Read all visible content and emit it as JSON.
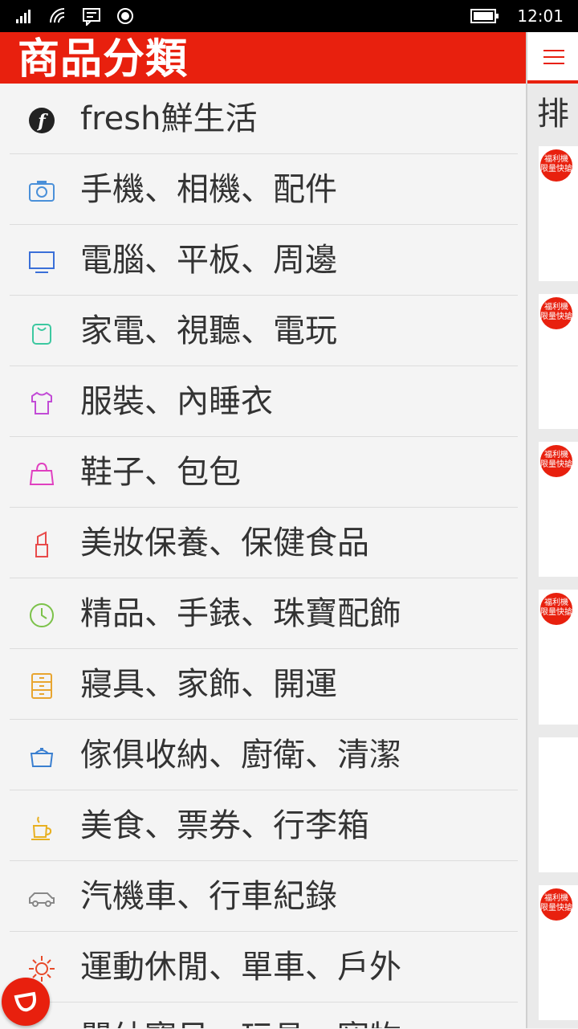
{
  "status_bar": {
    "time": "12:01",
    "icons": [
      "signal-icon",
      "wifi-icon",
      "message-icon",
      "location-icon",
      "battery-icon"
    ]
  },
  "drawer": {
    "title": "商品分類",
    "items": [
      {
        "label": "fresh鮮生活",
        "icon": "fresh-icon",
        "color": "#333333"
      },
      {
        "label": "手機、相機、配件",
        "icon": "camera-icon",
        "color": "#4a90d9"
      },
      {
        "label": "電腦、平板、周邊",
        "icon": "monitor-icon",
        "color": "#3a6fd8"
      },
      {
        "label": "家電、視聽、電玩",
        "icon": "bag-icon",
        "color": "#3cc8a0"
      },
      {
        "label": "服裝、內睡衣",
        "icon": "shirt-icon",
        "color": "#c24bd6"
      },
      {
        "label": "鞋子、包包",
        "icon": "handbag-icon",
        "color": "#e040c0"
      },
      {
        "label": "美妝保養、保健食品",
        "icon": "lipstick-icon",
        "color": "#e84a4a"
      },
      {
        "label": "精品、手錶、珠寶配飾",
        "icon": "clock-icon",
        "color": "#7cc24a"
      },
      {
        "label": "寢具、家飾、開運",
        "icon": "drawer-icon",
        "color": "#e8a530"
      },
      {
        "label": "傢俱收納、廚衛、清潔",
        "icon": "pot-icon",
        "color": "#3a7fd0"
      },
      {
        "label": "美食、票券、行李箱",
        "icon": "cup-icon",
        "color": "#e8b020"
      },
      {
        "label": "汽機車、行車紀錄",
        "icon": "car-icon",
        "color": "#888888"
      },
      {
        "label": "運動休閒、單車、戶外",
        "icon": "sun-icon",
        "color": "#e84a2a"
      },
      {
        "label": "嬰幼寶貝、玩具、寵物",
        "icon": "baby-icon",
        "color": "#c040c0"
      }
    ]
  },
  "main": {
    "rank_title": "排",
    "badge_text": [
      "福利機",
      "限量快搶!"
    ],
    "accent": "#e8200e"
  }
}
